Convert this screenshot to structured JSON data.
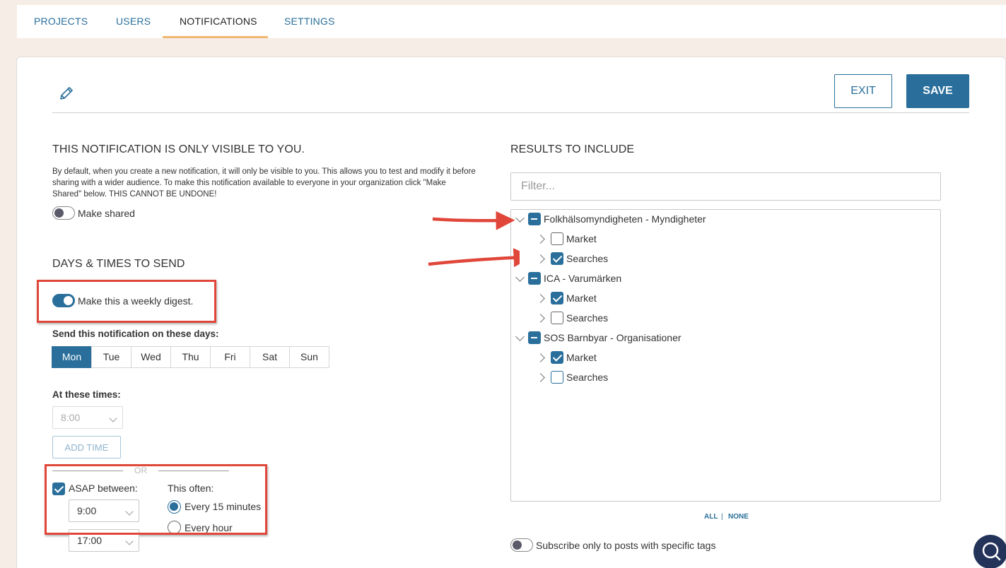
{
  "tabs": [
    {
      "label": "PROJECTS"
    },
    {
      "label": "USERS"
    },
    {
      "label": "NOTIFICATIONS",
      "active": true
    },
    {
      "label": "SETTINGS"
    }
  ],
  "header": {
    "exit_label": "EXIT",
    "save_label": "SAVE"
  },
  "visibility": {
    "heading": "THIS NOTIFICATION IS ONLY VISIBLE TO YOU.",
    "description": "By default, when you create a new notification, it will only be visible to you. This allows you to test and modify it before sharing with a wider audience. To make this notification available to everyone in your organization click \"Make Shared\" below. THIS CANNOT BE UNDONE!",
    "make_shared_label": "Make shared",
    "make_shared_on": false
  },
  "schedule": {
    "heading": "DAYS & TIMES TO SEND",
    "weekly_digest_label": "Make this a weekly digest.",
    "weekly_digest_on": true,
    "days_label": "Send this notification on these days:",
    "days": [
      "Mon",
      "Tue",
      "Wed",
      "Thu",
      "Fri",
      "Sat",
      "Sun"
    ],
    "selected_day": "Mon",
    "times_label": "At these times:",
    "time_value": "8:00",
    "add_time_label": "ADD TIME",
    "or_label": "OR",
    "asap_label": "ASAP between:",
    "asap_checked": true,
    "asap_from": "9:00",
    "asap_to": "17:00",
    "often_label": "This often:",
    "often_options": [
      "Every 15 minutes",
      "Every hour"
    ],
    "often_selected": "Every 15 minutes"
  },
  "results": {
    "heading": "RESULTS TO INCLUDE",
    "filter_placeholder": "Filter...",
    "tree": [
      {
        "label": "Folkhälsomyndigheten - Myndigheter",
        "state": "partial",
        "children": [
          {
            "label": "Market",
            "checked": false
          },
          {
            "label": "Searches",
            "checked": true
          }
        ]
      },
      {
        "label": "ICA - Varumärken",
        "state": "partial",
        "children": [
          {
            "label": "Market",
            "checked": true
          },
          {
            "label": "Searches",
            "checked": false
          }
        ]
      },
      {
        "label": "SOS Barnbyar - Organisationer",
        "state": "partial",
        "children": [
          {
            "label": "Market",
            "checked": true
          },
          {
            "label": "Searches",
            "checked": false
          }
        ]
      }
    ],
    "all_label": "ALL",
    "separator": "|",
    "none_label": "NONE",
    "subscribe_label": "Subscribe only to posts with specific tags",
    "subscribe_on": false
  },
  "colors": {
    "accent": "#2a6f9b",
    "tab_underline": "#f0b870",
    "annotation_red": "#e0473a"
  }
}
